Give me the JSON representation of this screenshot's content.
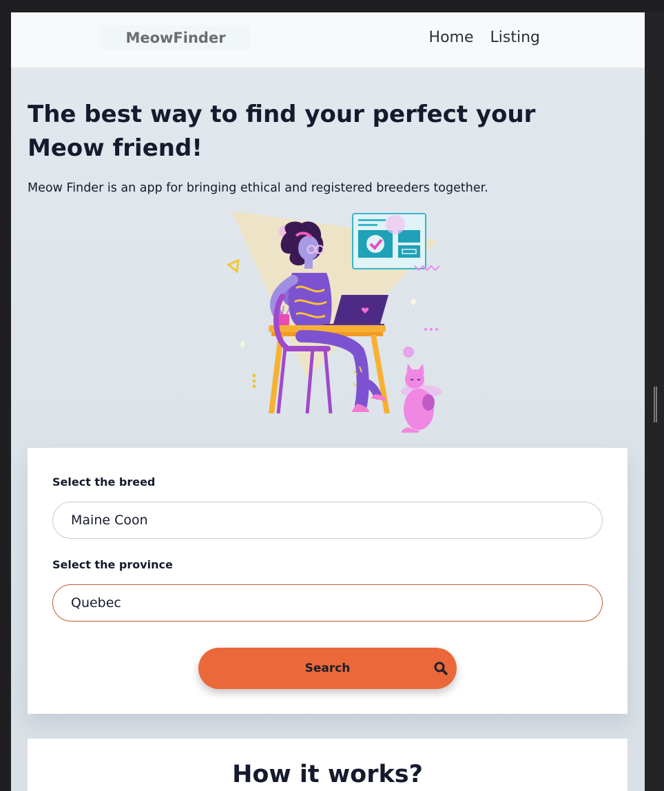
{
  "header": {
    "logo": "MeowFinder",
    "nav": [
      "Home",
      "Listing"
    ]
  },
  "hero": {
    "title": "The best way to find your perfect your Meow friend!",
    "subtitle": "Meow Finder is an app for bringing ethical and registered breeders together.",
    "illustration_icon": "woman-at-laptop-with-cat-illustration"
  },
  "search_form": {
    "breed_label": "Select the breed",
    "breed_value": "Maine Coon",
    "province_label": "Select the province",
    "province_value": "Quebec",
    "button_label": "Search",
    "button_icon": "search-icon"
  },
  "how_it_works": {
    "title": "How it works?"
  },
  "colors": {
    "accent": "#ea6839",
    "text": "#151a2c",
    "active_border": "#c8573a"
  }
}
